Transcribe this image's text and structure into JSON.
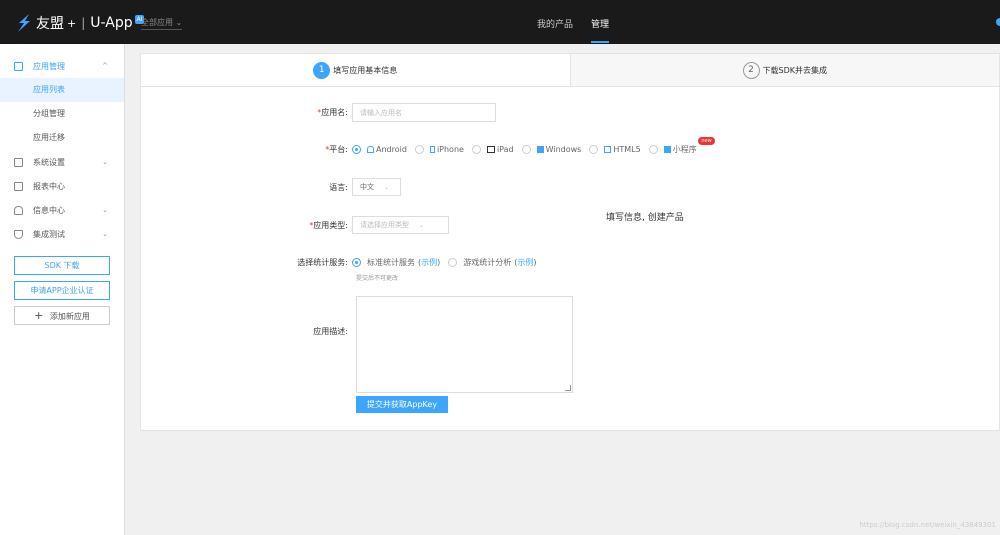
{
  "topbar": {
    "brand": "友盟",
    "plus": "+",
    "divider": "|",
    "product": "U-App",
    "badge": "AI",
    "app_selector": "全部应用",
    "nav": [
      "我的产品",
      "管理"
    ],
    "active_nav": "管理"
  },
  "sidebar": {
    "app_mgmt": "应用管理",
    "sub_items": [
      "应用列表",
      "分组管理",
      "应用迁移"
    ],
    "system_settings": "系统设置",
    "reports": "报表中心",
    "messages": "信息中心",
    "integration_test": "集成测试",
    "sdk_download": "SDK 下载",
    "enterprise_cert": "申请APP企业认证",
    "add_app": "添加新应用",
    "add_icon": "+"
  },
  "steps": [
    {
      "num": "1",
      "label": "填写应用基本信息"
    },
    {
      "num": "2",
      "label": "下载SDK并去集成"
    }
  ],
  "form": {
    "required_mark": "*",
    "app_name_label": "应用名:",
    "app_name_placeholder": "请输入应用名",
    "platform_label": "平台:",
    "platforms": [
      "Android",
      "iPhone",
      "iPad",
      "Windows",
      "HTML5",
      "小程序"
    ],
    "new_badge": "new",
    "language_label": "语言:",
    "language_value": "中文",
    "app_type_label": "应用类型:",
    "app_type_placeholder": "请选择应用类型",
    "service_label": "选择统计服务:",
    "service_standard": "标准统计服务",
    "service_game": "游戏统计分析",
    "example_open": "(",
    "example_text": "示例",
    "example_close": ")",
    "service_hint": "提交后不可更改",
    "desc_label": "应用描述:",
    "submit": "提交并获取AppKey"
  },
  "tip": "填写信息, 创建产品",
  "watermark": "https://blog.csdn.net/weixin_43849301",
  "colors": {
    "accent": "#3ba5ff",
    "topbar": "#1a1a1a",
    "required": "#e33333"
  }
}
